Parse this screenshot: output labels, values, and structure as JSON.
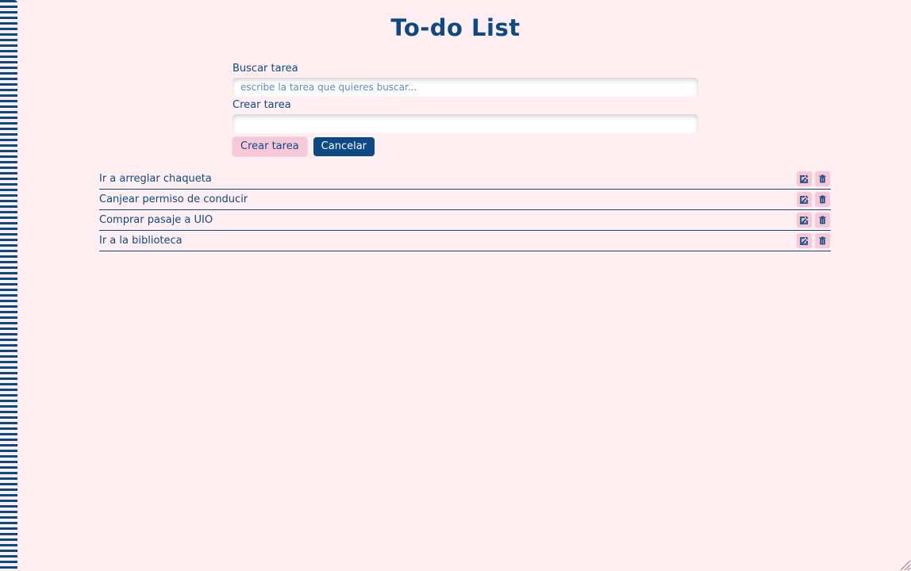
{
  "app": {
    "title": "To-do List"
  },
  "search": {
    "label": "Buscar tarea",
    "placeholder": "escribe la tarea que quieres buscar..."
  },
  "create": {
    "label": "Crear tarea",
    "value": ""
  },
  "buttons": {
    "create": "Crear tarea",
    "cancel": "Cancelar"
  },
  "tasks": [
    {
      "text": "Ir a arreglar chaqueta"
    },
    {
      "text": "Canjear permiso de conducir"
    },
    {
      "text": "Comprar pasaje a UIO"
    },
    {
      "text": "Ir a la biblioteca"
    }
  ],
  "icons": {
    "edit": "edit-icon",
    "delete": "trash-icon"
  },
  "colors": {
    "background": "#ffeef2",
    "primary": "#0b4a86",
    "accent": "#f8c8d6"
  }
}
